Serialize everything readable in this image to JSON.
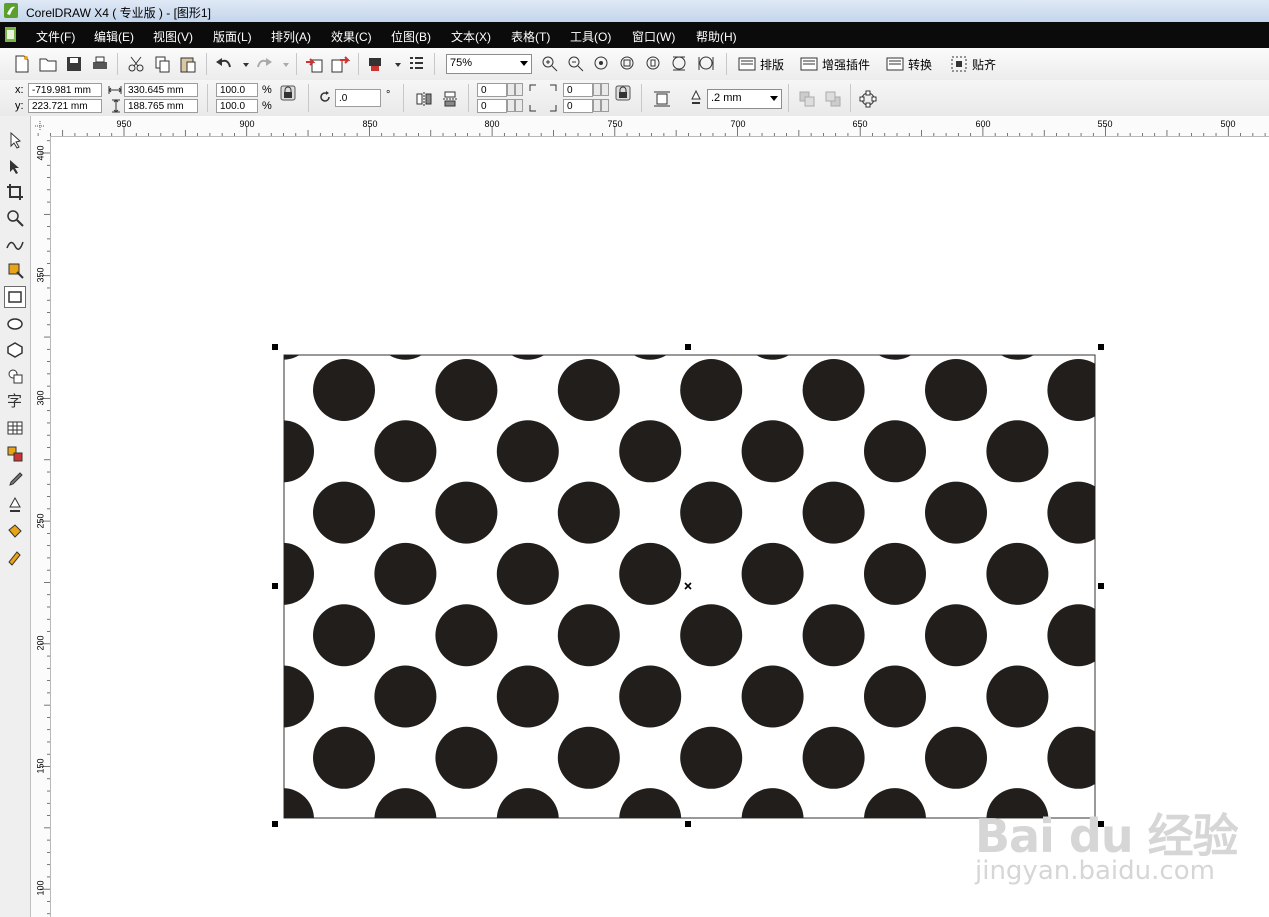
{
  "window": {
    "title": "CorelDRAW X4 ( 专业版 ) - [图形1]"
  },
  "menu": [
    "文件(F)",
    "编辑(E)",
    "视图(V)",
    "版面(L)",
    "排列(A)",
    "效果(C)",
    "位图(B)",
    "文本(X)",
    "表格(T)",
    "工具(O)",
    "窗口(W)",
    "帮助(H)"
  ],
  "toolbar": {
    "zoom": "75%",
    "plugins": [
      "排版",
      "增强插件",
      "转换",
      "贴齐"
    ]
  },
  "props": {
    "x_label": "x:",
    "x_value": "-719.981 mm",
    "y_label": "y:",
    "y_value": "223.721 mm",
    "width_value": "330.645 mm",
    "height_value": "188.765 mm",
    "scale_x": "100.0",
    "scale_y": "100.0",
    "percent": "%",
    "rotation": ".0",
    "degree": "°",
    "corner_tl": "0",
    "corner_bl": "0",
    "corner_tr": "0",
    "corner_br": "0",
    "outline_width": ".2 mm"
  },
  "ruler": {
    "h_labels": [
      "950",
      "900",
      "850",
      "800",
      "750",
      "700",
      "650",
      "600",
      "550",
      "500"
    ],
    "v_labels": [
      "400",
      "350",
      "300",
      "250",
      "200",
      "150",
      "100"
    ]
  },
  "document": {
    "pattern": "polka-dot",
    "dot_color": "#221e1b",
    "background": "#ffffff"
  },
  "watermark": {
    "brand": "Bai du 经验",
    "sub": "jingyan.baidu.com"
  }
}
